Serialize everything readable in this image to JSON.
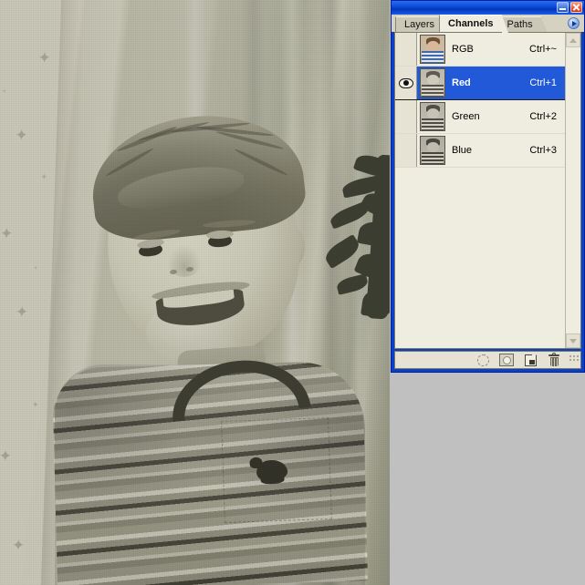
{
  "window": {
    "titlebar": {
      "minimize_label": "Minimize",
      "close_label": "Close"
    },
    "tabs": [
      {
        "label": "Layers",
        "active": false
      },
      {
        "label": "Channels",
        "active": true
      },
      {
        "label": "Paths",
        "active": false
      }
    ],
    "palette_menu_label": "Palette menu"
  },
  "channels": [
    {
      "name": "RGB",
      "shortcut": "Ctrl+~",
      "visible": false,
      "selected": false,
      "thumb": "color"
    },
    {
      "name": "Red",
      "shortcut": "Ctrl+1",
      "visible": true,
      "selected": true,
      "thumb": "gray"
    },
    {
      "name": "Green",
      "shortcut": "Ctrl+2",
      "visible": false,
      "selected": false,
      "thumb": "gray"
    },
    {
      "name": "Blue",
      "shortcut": "Ctrl+3",
      "visible": false,
      "selected": false,
      "thumb": "gray"
    }
  ],
  "bottom_toolbar": [
    {
      "icon": "load-channel-as-selection-icon",
      "label": "Load channel as selection"
    },
    {
      "icon": "save-selection-as-channel-icon",
      "label": "Save selection as channel"
    },
    {
      "icon": "new-channel-icon",
      "label": "Create new channel"
    },
    {
      "icon": "delete-channel-icon",
      "label": "Delete current channel"
    }
  ],
  "scrollbar": {
    "up_label": "Scroll up",
    "down_label": "Scroll down"
  },
  "canvas": {
    "description": "Sepia-toned photograph of a smiling young boy in a horizontally striped shirt with a bear logo on the chest pocket, standing in front of a curtain and star-patterned wallpaper, with a dark houseplant silhouette at the right."
  },
  "colors": {
    "titlebar_blue": "#0a49d6",
    "selection_blue": "#2159d8",
    "panel_beige": "#efece0",
    "desktop_gray": "#c0c0c0",
    "close_red": "#d62b14"
  }
}
